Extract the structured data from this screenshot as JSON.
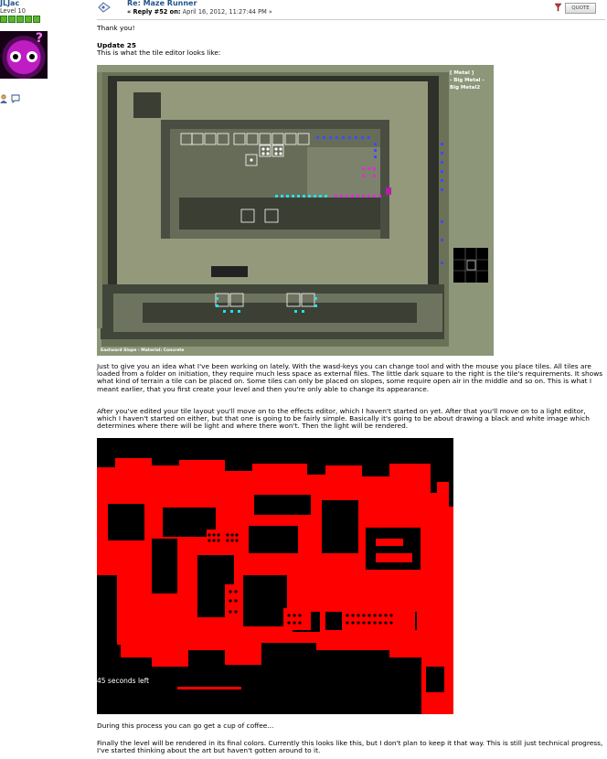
{
  "author": {
    "name": "JLJac",
    "level": "Level 10",
    "star_count": 5,
    "icons": [
      "profile-icon",
      "message-icon"
    ]
  },
  "post": {
    "title": "Re: Maze Runner",
    "reply_label": "« Reply #52 on:",
    "date": "April 16, 2012, 11:27:44 PM »",
    "quote_label": "QUOTE"
  },
  "body": {
    "thanks": "Thank you!",
    "update_heading": "Update 25",
    "intro": "This is what the tile editor looks like:",
    "paragraph1": "Just to give you an idea what I've been working on lately. With the wasd-keys you can change tool and with the mouse you place tiles. All tiles are loaded from a folder on initiation, they require much less space as external files. The little dark square to the right is the tile's requirements. It shows what kind of terrain a tile can be placed on. Some tiles can only be placed on slopes, some require open air in the middle and so on. This is what I meant earlier, that you first create your level and then you're only able to change its appearance.",
    "paragraph2": "After you've edited your tile layout you'll move on to the effects editor, which I haven't started on yet. After that you'll move on to a light editor, which I haven't started on either, but that one is going to be fairly simple. Basically it's going to be about drawing a black and white image which determines where there will be light and where there won't. Then the light will be rendered.",
    "paragraph3": "During this process you can go get a cup of coffee...",
    "paragraph4": "Finally the level will be rendered in its final colors. Currently this looks like this, but I don't plan to keep it that way. This is still just technical progress, I've started thinking about the art but haven't gotten around to it."
  },
  "editor_image": {
    "tile_label_1": "[ Metal ]",
    "tile_label_2": "- Big Metal -",
    "tile_label_3": "Big Metal2",
    "status": "Eastward Slope - Material: Concrete"
  },
  "render_image": {
    "timer": "45 seconds left"
  },
  "colors": {
    "link": "#22538b",
    "editor_bg": "#8d9679",
    "render_red": "#ff0000"
  }
}
